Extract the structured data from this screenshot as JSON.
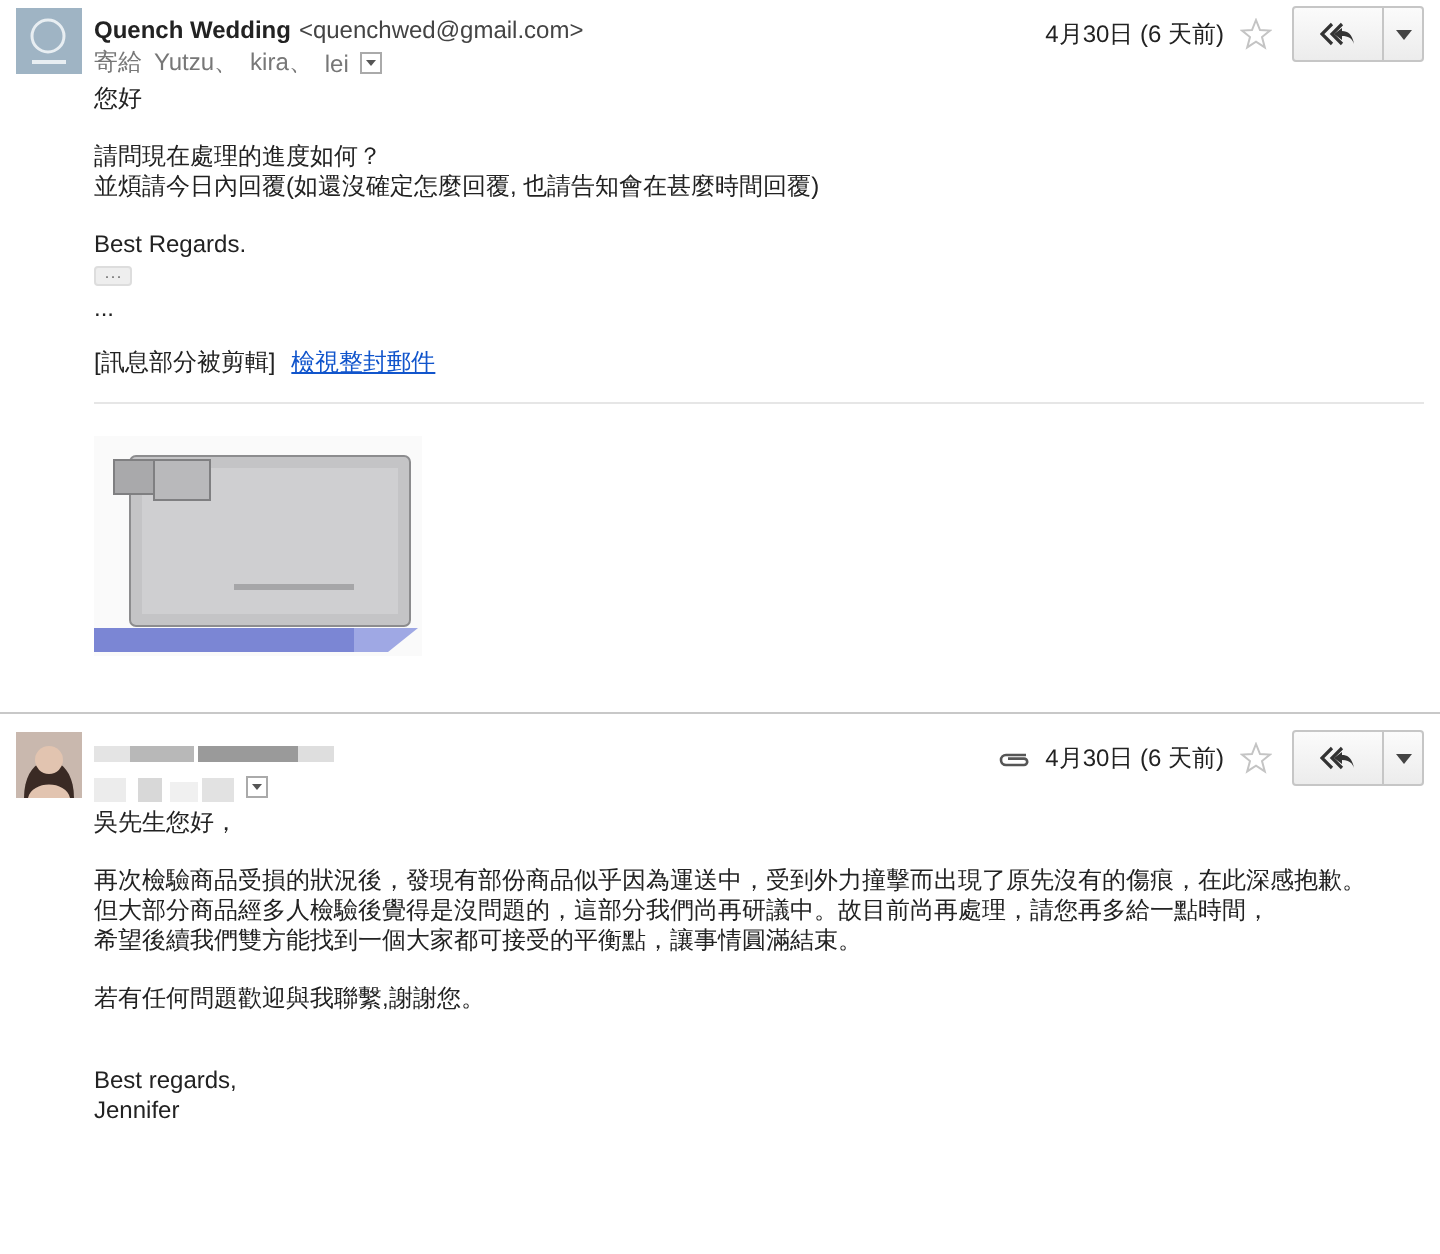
{
  "messages": [
    {
      "kind": "logo",
      "sender": {
        "name": "Quench Wedding",
        "email": "<quenchwed@gmail.com>"
      },
      "recipients_label": "寄給",
      "recipients": [
        "Yutzu、",
        "kira、",
        "lei"
      ],
      "date": "4月30日 (6 天前)",
      "starred": false,
      "body": [
        {
          "kind": "para",
          "lines": [
            "您好"
          ]
        },
        {
          "kind": "para",
          "lines": [
            "請問現在處理的進度如何？",
            "並煩請今日內回覆(如還沒確定怎麼回覆, 也請告知會在甚麼時間回覆)"
          ]
        },
        {
          "kind": "para",
          "lines": [
            "Best Regards."
          ]
        },
        {
          "kind": "more",
          "label": "···"
        },
        {
          "kind": "tight",
          "lines": [
            "..."
          ]
        },
        {
          "kind": "trim",
          "note": "[訊息部分被剪輯]",
          "link": "檢視整封郵件"
        },
        {
          "kind": "attachment"
        }
      ]
    },
    {
      "kind": "person",
      "sender": {
        "redacted": true
      },
      "date": "4月30日 (6 天前)",
      "starred": false,
      "has_attachment": true,
      "body": [
        {
          "kind": "para",
          "lines": [
            "吳先生您好，"
          ]
        },
        {
          "kind": "para",
          "lines": [
            "再次檢驗商品受損的狀況後，發現有部份商品似乎因為運送中，受到外力撞擊而出現了原先沒有的傷痕，在此深感抱歉。",
            "但大部分商品經多人檢驗後覺得是沒問題的，這部分我們尚再研議中。故目前尚再處理，請您再多給一點時間，",
            "希望後續我們雙方能找到一個大家都可接受的平衡點，讓事情圓滿結束。"
          ]
        },
        {
          "kind": "wide",
          "lines": [
            "若有任何問題歡迎與我聯繫,謝謝您。"
          ]
        },
        {
          "kind": "wide",
          "lines": [
            "Best regards,",
            "Jennifer"
          ]
        }
      ]
    }
  ]
}
